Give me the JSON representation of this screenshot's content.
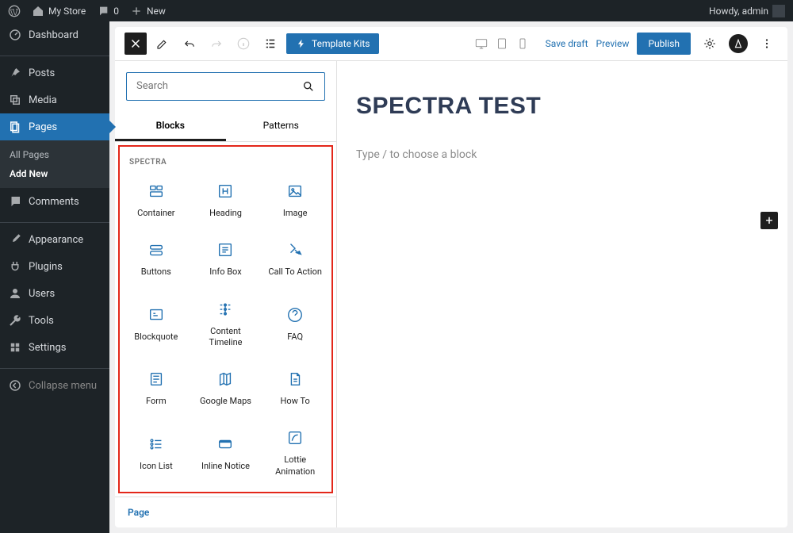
{
  "adminbar": {
    "site": "My Store",
    "comments": "0",
    "new": "New",
    "howdy": "Howdy, admin"
  },
  "sidebar": {
    "items": [
      {
        "label": "Dashboard"
      },
      {
        "label": "Posts"
      },
      {
        "label": "Media"
      },
      {
        "label": "Pages"
      },
      {
        "label": "Comments"
      },
      {
        "label": "Appearance"
      },
      {
        "label": "Plugins"
      },
      {
        "label": "Users"
      },
      {
        "label": "Tools"
      },
      {
        "label": "Settings"
      },
      {
        "label": "Collapse menu"
      }
    ],
    "sub": {
      "all": "All Pages",
      "add": "Add New"
    }
  },
  "toolbar": {
    "template_kits": "Template Kits",
    "save_draft": "Save draft",
    "preview": "Preview",
    "publish": "Publish"
  },
  "inserter": {
    "search_placeholder": "Search",
    "tab_blocks": "Blocks",
    "tab_patterns": "Patterns",
    "section": "SPECTRA",
    "blocks": [
      {
        "label": "Container"
      },
      {
        "label": "Heading"
      },
      {
        "label": "Image"
      },
      {
        "label": "Buttons"
      },
      {
        "label": "Info Box"
      },
      {
        "label": "Call To Action"
      },
      {
        "label": "Blockquote"
      },
      {
        "label": "Content Timeline"
      },
      {
        "label": "FAQ"
      },
      {
        "label": "Form"
      },
      {
        "label": "Google Maps"
      },
      {
        "label": "How To"
      },
      {
        "label": "Icon List"
      },
      {
        "label": "Inline Notice"
      },
      {
        "label": "Lottie Animation"
      }
    ],
    "footer": "Page"
  },
  "canvas": {
    "title": "SPECTRA TEST",
    "placeholder": "Type / to choose a block"
  }
}
